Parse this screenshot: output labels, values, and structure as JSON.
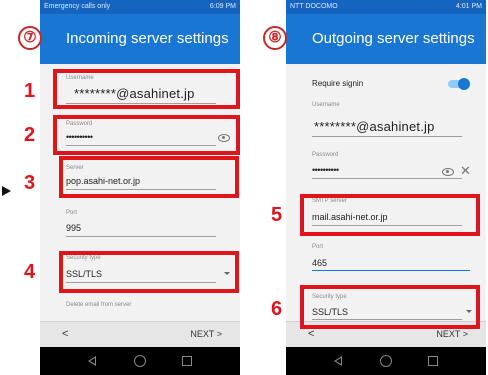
{
  "step_left": "⑦",
  "step_right": "⑧",
  "left": {
    "status_left": "Emergency calls only",
    "status_right": "6:09 PM",
    "title": "Incoming server settings",
    "username_label": "Username",
    "username_value": "********@asahinet.jp",
    "password_label": "Password",
    "password_value": "••••••••••",
    "server_label": "Server",
    "server_value": "pop.asahi-net.or.jp",
    "port_label": "Port",
    "port_value": "995",
    "security_label": "Security type",
    "security_value": "SSL/TLS",
    "delete_label": "Delete email from server",
    "back_label": "<",
    "next_label": "NEXT >"
  },
  "right": {
    "status_left": "NTT DOCOMO",
    "status_right": "4:01 PM",
    "title": "Outgoing server settings",
    "require_signin_label": "Require signin",
    "require_signin_on": true,
    "username_label": "Username",
    "username_value": "********@asahinet.jp",
    "password_label": "Password",
    "password_value": "••••••••••",
    "smtp_label": "SMTP server",
    "smtp_value": "mail.asahi-net.or.jp",
    "port_label": "Port",
    "port_value": "465",
    "security_label": "Security type",
    "security_value": "SSL/TLS",
    "back_label": "<",
    "next_label": "NEXT >"
  },
  "callouts": [
    "1",
    "2",
    "3",
    "4",
    "5",
    "6"
  ],
  "colors": {
    "accent_blue": "#1976d2",
    "statusbar_blue": "#1565c0",
    "highlight_red": "#e0141b"
  },
  "icons": [
    "eye-icon",
    "clear-icon",
    "dropdown-caret-icon",
    "nav-back-icon",
    "nav-home-icon",
    "nav-recents-icon",
    "pointer-arrow-icon"
  ]
}
